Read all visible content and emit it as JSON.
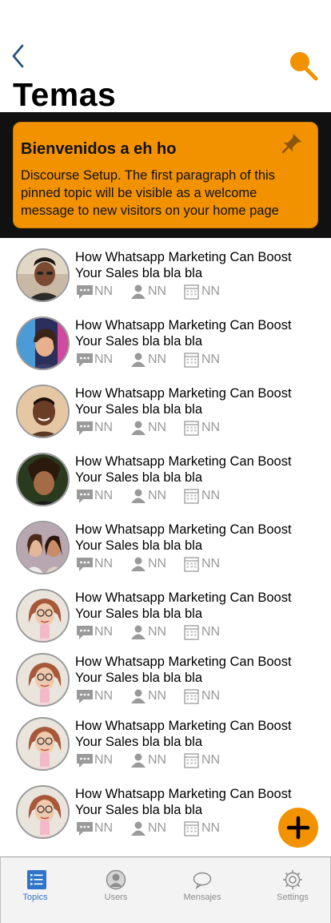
{
  "header": {
    "title": "Temas"
  },
  "pinned": {
    "title": "Bienvenidos a eh ho",
    "body": "Discourse Setup. The first paragraph of this pinned topic will be visible as a welcome message to new visitors on your home page"
  },
  "topics": [
    {
      "title": "How Whatsapp Marketing Can Boost Your Sales bla bla bla",
      "replies": "NN",
      "users": "NN",
      "date": "NN",
      "avatar": "young-man-portrait"
    },
    {
      "title": "How Whatsapp Marketing Can Boost Your Sales bla bla bla",
      "replies": "NN",
      "users": "NN",
      "date": "NN",
      "avatar": "woman-neon-lights"
    },
    {
      "title": "How Whatsapp Marketing Can Boost Your Sales bla bla bla",
      "replies": "NN",
      "users": "NN",
      "date": "NN",
      "avatar": "smiling-man"
    },
    {
      "title": "How Whatsapp Marketing Can Boost Your Sales bla bla bla",
      "replies": "NN",
      "users": "NN",
      "date": "NN",
      "avatar": "curly-hair-man"
    },
    {
      "title": "How Whatsapp Marketing Can Boost Your Sales bla bla bla",
      "replies": "NN",
      "users": "NN",
      "date": "NN",
      "avatar": "two-women"
    },
    {
      "title": "How Whatsapp Marketing Can Boost Your Sales bla bla bla",
      "replies": "NN",
      "users": "NN",
      "date": "NN",
      "avatar": "woman-glasses"
    },
    {
      "title": "How Whatsapp Marketing Can Boost Your Sales bla bla bla",
      "replies": "NN",
      "users": "NN",
      "date": "NN",
      "avatar": "woman-glasses"
    },
    {
      "title": "How Whatsapp Marketing Can Boost Your Sales bla bla bla",
      "replies": "NN",
      "users": "NN",
      "date": "NN",
      "avatar": "woman-glasses"
    },
    {
      "title": "How Whatsapp Marketing Can Boost Your Sales bla bla bla",
      "replies": "NN",
      "users": "NN",
      "date": "NN",
      "avatar": "woman-glasses"
    }
  ],
  "tabbar": {
    "items": [
      {
        "label": "Topics",
        "icon": "list-icon",
        "active": true
      },
      {
        "label": "Users",
        "icon": "user-icon",
        "active": false
      },
      {
        "label": "Mensajes",
        "icon": "chat-bubble-icon",
        "active": false
      },
      {
        "label": "Settings",
        "icon": "gear-icon",
        "active": false
      }
    ]
  },
  "colors": {
    "accent": "#f39200",
    "active_tab": "#2f74c8",
    "meta_gray": "#9a9a9a",
    "back_arrow": "#1f4e79"
  }
}
